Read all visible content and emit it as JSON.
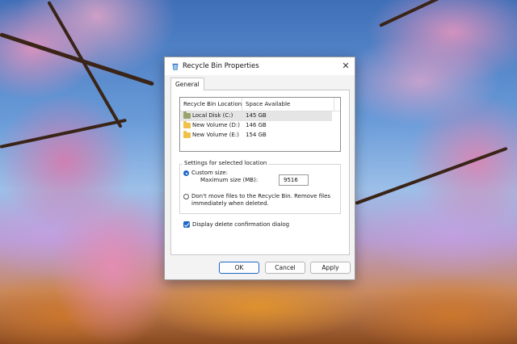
{
  "dialog": {
    "title": "Recycle Bin Properties",
    "close_glyph": "✕",
    "tab_label": "General"
  },
  "listview": {
    "columns": [
      "Recycle Bin Location",
      "Space Available"
    ],
    "rows": [
      {
        "name": "Local Disk (C:)",
        "space": "145 GB",
        "icon": "drive-icon",
        "icon_color": "#9aa36a",
        "selected": true
      },
      {
        "name": "New Volume (D:)",
        "space": "146 GB",
        "icon": "folder-icon",
        "icon_color": "#f0c24a",
        "selected": false
      },
      {
        "name": "New Volume (E:)",
        "space": "154 GB",
        "icon": "folder-icon",
        "icon_color": "#f0c24a",
        "selected": false
      }
    ]
  },
  "settings": {
    "group_label": "Settings for selected location",
    "custom_size_label": "Custom size:",
    "custom_size_selected": true,
    "max_size_label": "Maximum size (MB):",
    "max_size_value": "9516",
    "dont_move_line1": "Don't move files to the Recycle Bin. Remove files",
    "dont_move_line2": "immediately when deleted.",
    "dont_move_selected": false,
    "confirm_label": "Display delete confirmation dialog",
    "confirm_checked": true
  },
  "buttons": {
    "ok": "OK",
    "cancel": "Cancel",
    "apply": "Apply"
  },
  "colors": {
    "accent": "#1e66c9"
  }
}
